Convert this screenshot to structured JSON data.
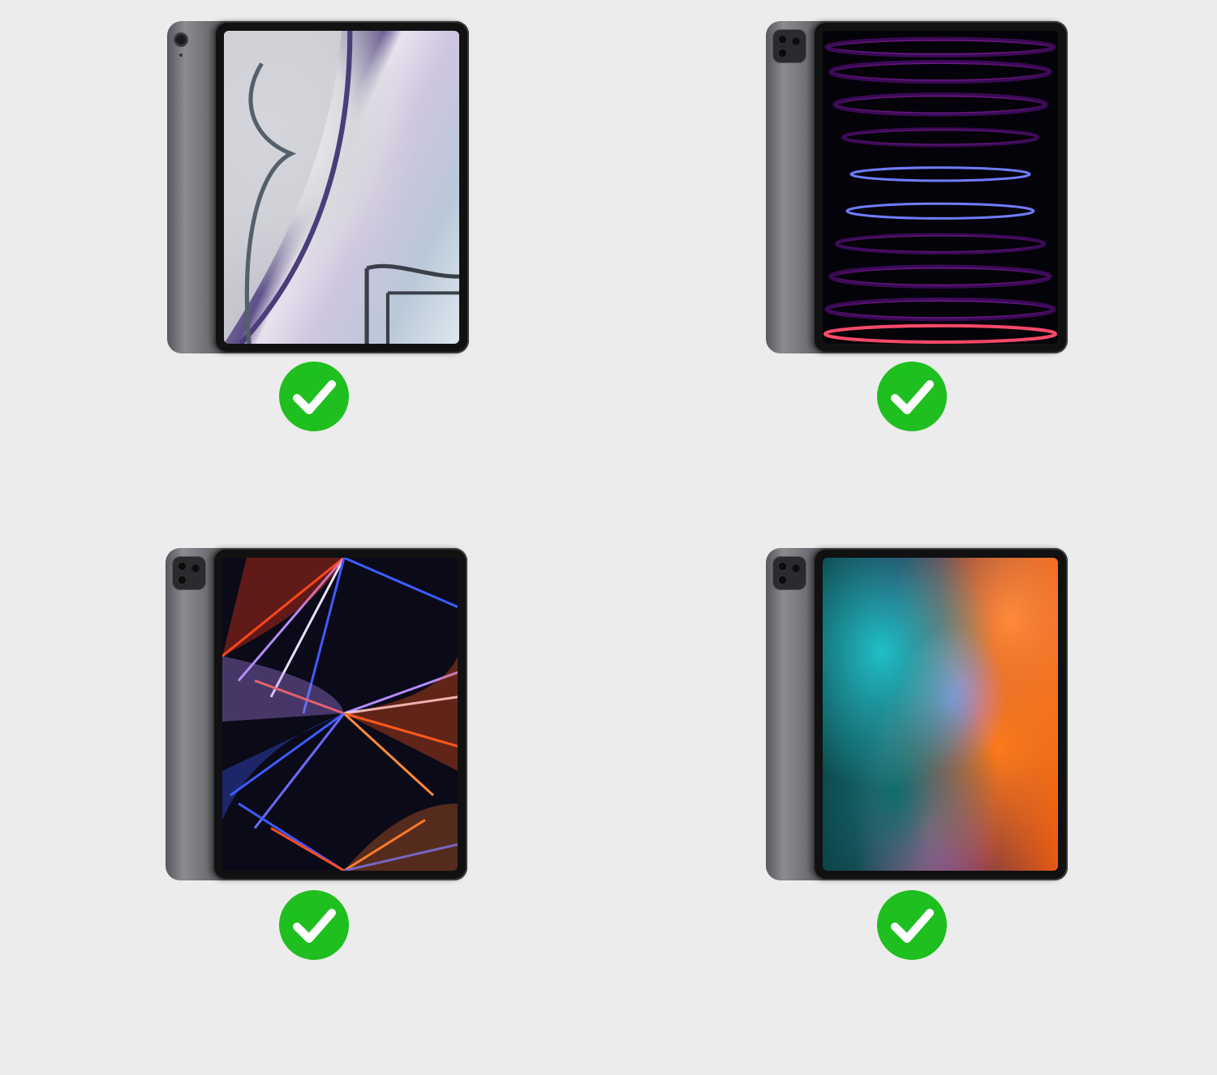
{
  "devices": [
    {
      "model_art": "ipad-air-wallpaper",
      "camera": "single-lens",
      "compatible": true
    },
    {
      "model_art": "ipad-pro-6th-gen-wallpaper",
      "camera": "dual-lens-module",
      "compatible": true
    },
    {
      "model_art": "ipad-pro-5th-gen-wallpaper",
      "camera": "dual-lens-module",
      "compatible": true
    },
    {
      "model_art": "ipad-pro-4th-gen-wallpaper",
      "camera": "dual-lens-module",
      "compatible": true
    }
  ],
  "colors": {
    "background": "#ececec",
    "check_green": "#1fbf1f",
    "check_mark": "#ffffff",
    "device_body": "#6b6d72"
  },
  "icons": [
    "check-circle-icon"
  ]
}
